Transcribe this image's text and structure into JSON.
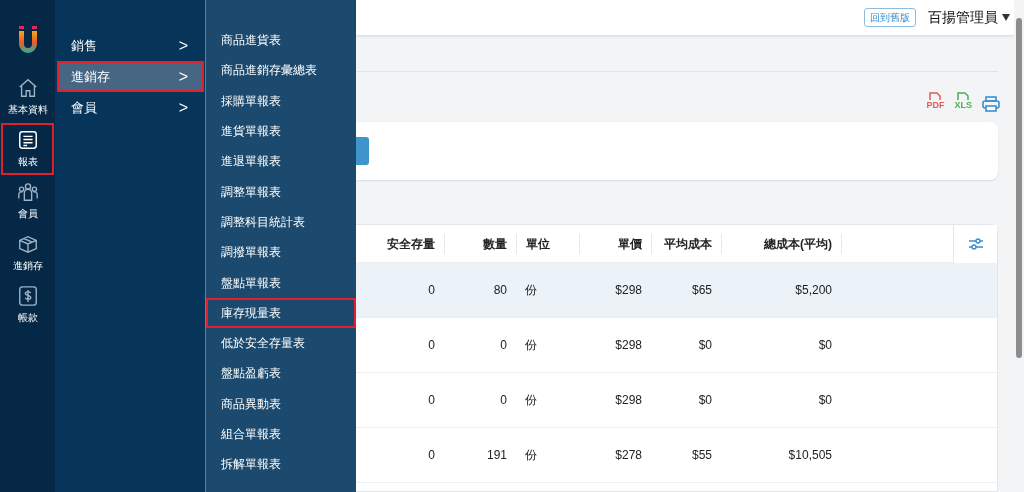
{
  "sidebar": {
    "items": [
      {
        "label": "基本資料",
        "highlighted": false
      },
      {
        "label": "報表",
        "highlighted": true
      },
      {
        "label": "會員",
        "highlighted": false
      },
      {
        "label": "進銷存",
        "highlighted": false
      },
      {
        "label": "帳款",
        "highlighted": false
      }
    ]
  },
  "menu": {
    "items": [
      {
        "label": "銷售",
        "arrow": ">",
        "selected": false,
        "highlighted": false
      },
      {
        "label": "進銷存",
        "arrow": ">",
        "selected": true,
        "highlighted": true
      },
      {
        "label": "會員",
        "arrow": ">",
        "selected": false,
        "highlighted": false
      }
    ]
  },
  "submenu": {
    "items": [
      {
        "label": "商品進貨表",
        "highlighted": false
      },
      {
        "label": "商品進銷存彙總表",
        "highlighted": false
      },
      {
        "label": "採購單報表",
        "highlighted": false
      },
      {
        "label": "進貨單報表",
        "highlighted": false
      },
      {
        "label": "進退單報表",
        "highlighted": false
      },
      {
        "label": "調整單報表",
        "highlighted": false
      },
      {
        "label": "調整科目統計表",
        "highlighted": false
      },
      {
        "label": "調撥單報表",
        "highlighted": false
      },
      {
        "label": "盤點單報表",
        "highlighted": false
      },
      {
        "label": "庫存現量表",
        "highlighted": true
      },
      {
        "label": "低於安全存量表",
        "highlighted": false
      },
      {
        "label": "盤點盈虧表",
        "highlighted": false
      },
      {
        "label": "商品異動表",
        "highlighted": false
      },
      {
        "label": "組合單報表",
        "highlighted": false
      },
      {
        "label": "拆解單報表",
        "highlighted": false
      }
    ]
  },
  "topbar": {
    "legacy_button": "回到舊版",
    "user": "百揚管理員"
  },
  "export_buttons": [
    {
      "label": "PDF",
      "color": "#e8595a"
    },
    {
      "label": "XLS",
      "color": "#4caf50"
    }
  ],
  "table": {
    "columns": [
      "安全存量",
      "數量",
      "單位",
      "單價",
      "平均成本",
      "總成本(平均)"
    ],
    "rows": [
      {
        "selected": true,
        "cells": [
          "0",
          "80",
          "份",
          "$298",
          "$65",
          "$5,200"
        ]
      },
      {
        "selected": false,
        "cells": [
          "0",
          "0",
          "份",
          "$298",
          "$0",
          "$0"
        ]
      },
      {
        "selected": false,
        "cells": [
          "0",
          "0",
          "份",
          "$298",
          "$0",
          "$0"
        ]
      },
      {
        "selected": false,
        "cells": [
          "0",
          "191",
          "份",
          "$278",
          "$55",
          "$10,505"
        ]
      }
    ]
  }
}
